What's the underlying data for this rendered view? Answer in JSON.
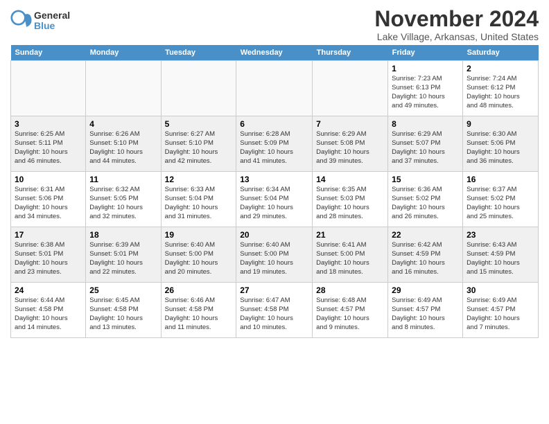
{
  "logo": {
    "general": "General",
    "blue": "Blue"
  },
  "title": "November 2024",
  "location": "Lake Village, Arkansas, United States",
  "headers": [
    "Sunday",
    "Monday",
    "Tuesday",
    "Wednesday",
    "Thursday",
    "Friday",
    "Saturday"
  ],
  "weeks": [
    [
      {
        "day": "",
        "info": ""
      },
      {
        "day": "",
        "info": ""
      },
      {
        "day": "",
        "info": ""
      },
      {
        "day": "",
        "info": ""
      },
      {
        "day": "",
        "info": ""
      },
      {
        "day": "1",
        "info": "Sunrise: 7:23 AM\nSunset: 6:13 PM\nDaylight: 10 hours\nand 49 minutes."
      },
      {
        "day": "2",
        "info": "Sunrise: 7:24 AM\nSunset: 6:12 PM\nDaylight: 10 hours\nand 48 minutes."
      }
    ],
    [
      {
        "day": "3",
        "info": "Sunrise: 6:25 AM\nSunset: 5:11 PM\nDaylight: 10 hours\nand 46 minutes."
      },
      {
        "day": "4",
        "info": "Sunrise: 6:26 AM\nSunset: 5:10 PM\nDaylight: 10 hours\nand 44 minutes."
      },
      {
        "day": "5",
        "info": "Sunrise: 6:27 AM\nSunset: 5:10 PM\nDaylight: 10 hours\nand 42 minutes."
      },
      {
        "day": "6",
        "info": "Sunrise: 6:28 AM\nSunset: 5:09 PM\nDaylight: 10 hours\nand 41 minutes."
      },
      {
        "day": "7",
        "info": "Sunrise: 6:29 AM\nSunset: 5:08 PM\nDaylight: 10 hours\nand 39 minutes."
      },
      {
        "day": "8",
        "info": "Sunrise: 6:29 AM\nSunset: 5:07 PM\nDaylight: 10 hours\nand 37 minutes."
      },
      {
        "day": "9",
        "info": "Sunrise: 6:30 AM\nSunset: 5:06 PM\nDaylight: 10 hours\nand 36 minutes."
      }
    ],
    [
      {
        "day": "10",
        "info": "Sunrise: 6:31 AM\nSunset: 5:06 PM\nDaylight: 10 hours\nand 34 minutes."
      },
      {
        "day": "11",
        "info": "Sunrise: 6:32 AM\nSunset: 5:05 PM\nDaylight: 10 hours\nand 32 minutes."
      },
      {
        "day": "12",
        "info": "Sunrise: 6:33 AM\nSunset: 5:04 PM\nDaylight: 10 hours\nand 31 minutes."
      },
      {
        "day": "13",
        "info": "Sunrise: 6:34 AM\nSunset: 5:04 PM\nDaylight: 10 hours\nand 29 minutes."
      },
      {
        "day": "14",
        "info": "Sunrise: 6:35 AM\nSunset: 5:03 PM\nDaylight: 10 hours\nand 28 minutes."
      },
      {
        "day": "15",
        "info": "Sunrise: 6:36 AM\nSunset: 5:02 PM\nDaylight: 10 hours\nand 26 minutes."
      },
      {
        "day": "16",
        "info": "Sunrise: 6:37 AM\nSunset: 5:02 PM\nDaylight: 10 hours\nand 25 minutes."
      }
    ],
    [
      {
        "day": "17",
        "info": "Sunrise: 6:38 AM\nSunset: 5:01 PM\nDaylight: 10 hours\nand 23 minutes."
      },
      {
        "day": "18",
        "info": "Sunrise: 6:39 AM\nSunset: 5:01 PM\nDaylight: 10 hours\nand 22 minutes."
      },
      {
        "day": "19",
        "info": "Sunrise: 6:40 AM\nSunset: 5:00 PM\nDaylight: 10 hours\nand 20 minutes."
      },
      {
        "day": "20",
        "info": "Sunrise: 6:40 AM\nSunset: 5:00 PM\nDaylight: 10 hours\nand 19 minutes."
      },
      {
        "day": "21",
        "info": "Sunrise: 6:41 AM\nSunset: 5:00 PM\nDaylight: 10 hours\nand 18 minutes."
      },
      {
        "day": "22",
        "info": "Sunrise: 6:42 AM\nSunset: 4:59 PM\nDaylight: 10 hours\nand 16 minutes."
      },
      {
        "day": "23",
        "info": "Sunrise: 6:43 AM\nSunset: 4:59 PM\nDaylight: 10 hours\nand 15 minutes."
      }
    ],
    [
      {
        "day": "24",
        "info": "Sunrise: 6:44 AM\nSunset: 4:58 PM\nDaylight: 10 hours\nand 14 minutes."
      },
      {
        "day": "25",
        "info": "Sunrise: 6:45 AM\nSunset: 4:58 PM\nDaylight: 10 hours\nand 13 minutes."
      },
      {
        "day": "26",
        "info": "Sunrise: 6:46 AM\nSunset: 4:58 PM\nDaylight: 10 hours\nand 11 minutes."
      },
      {
        "day": "27",
        "info": "Sunrise: 6:47 AM\nSunset: 4:58 PM\nDaylight: 10 hours\nand 10 minutes."
      },
      {
        "day": "28",
        "info": "Sunrise: 6:48 AM\nSunset: 4:57 PM\nDaylight: 10 hours\nand 9 minutes."
      },
      {
        "day": "29",
        "info": "Sunrise: 6:49 AM\nSunset: 4:57 PM\nDaylight: 10 hours\nand 8 minutes."
      },
      {
        "day": "30",
        "info": "Sunrise: 6:49 AM\nSunset: 4:57 PM\nDaylight: 10 hours\nand 7 minutes."
      }
    ]
  ]
}
